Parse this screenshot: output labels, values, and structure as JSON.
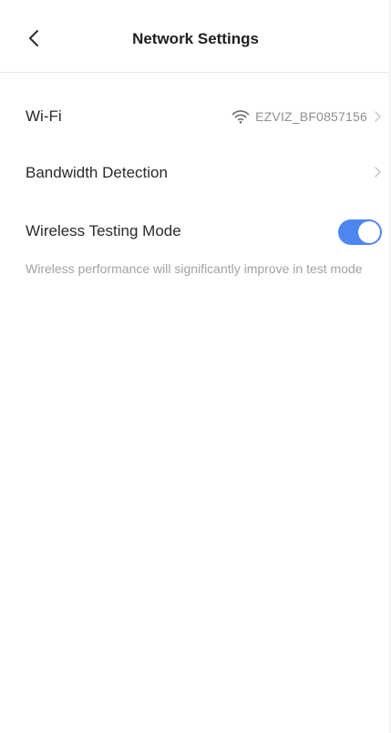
{
  "header": {
    "title": "Network Settings",
    "back_icon": "chevron-left-icon"
  },
  "settings": {
    "wifi": {
      "label": "Wi-Fi",
      "value": "EZVIZ_BF0857156",
      "icon": "wifi-icon"
    },
    "bandwidth": {
      "label": "Bandwidth Detection"
    },
    "wireless_testing": {
      "label": "Wireless Testing Mode",
      "enabled": true,
      "description": "Wireless performance will significantly improve in test mode"
    }
  },
  "colors": {
    "accent": "#4d86ee",
    "text_primary": "#2a2a2a",
    "text_secondary": "#8f8f94",
    "hint": "#a2a2a7"
  }
}
